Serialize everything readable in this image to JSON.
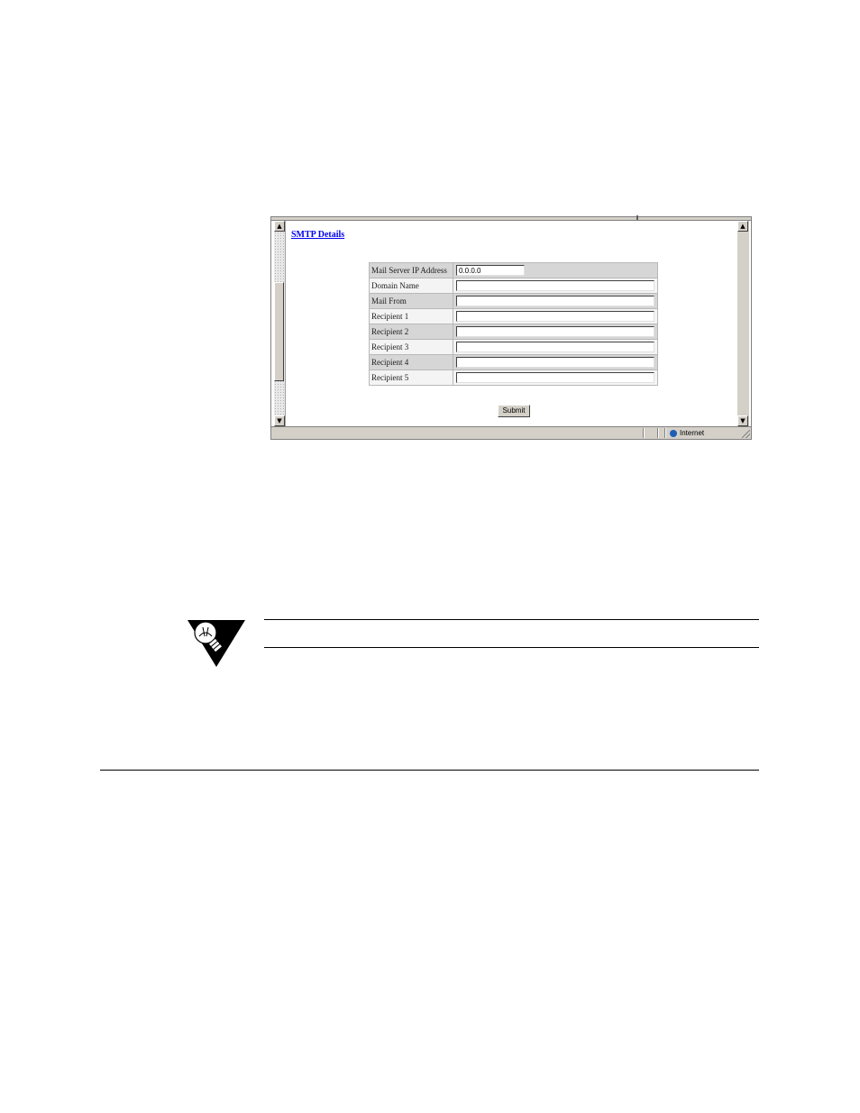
{
  "smtp_page": {
    "title": "SMTP Details",
    "fields": [
      {
        "label": "Mail Server IP Address",
        "value": "0.0.0.0"
      },
      {
        "label": "Domain Name",
        "value": ""
      },
      {
        "label": "Mail From",
        "value": ""
      },
      {
        "label": "Recipient 1",
        "value": ""
      },
      {
        "label": "Recipient 2",
        "value": ""
      },
      {
        "label": "Recipient 3",
        "value": ""
      },
      {
        "label": "Recipient 4",
        "value": ""
      },
      {
        "label": "Recipient 5",
        "value": ""
      }
    ],
    "submit_label": "Submit"
  },
  "statusbar": {
    "zone": "Internet"
  },
  "icons": {
    "scroll_up": "scroll-up-arrow-icon",
    "scroll_down": "scroll-down-arrow-icon",
    "zone": "globe-icon",
    "note": "lightbulb-note-icon"
  },
  "colors": {
    "link": "#0000ee",
    "row_odd": "#d6d6d6",
    "row_even": "#f4f4f4",
    "chrome": "#d4d0c8"
  }
}
